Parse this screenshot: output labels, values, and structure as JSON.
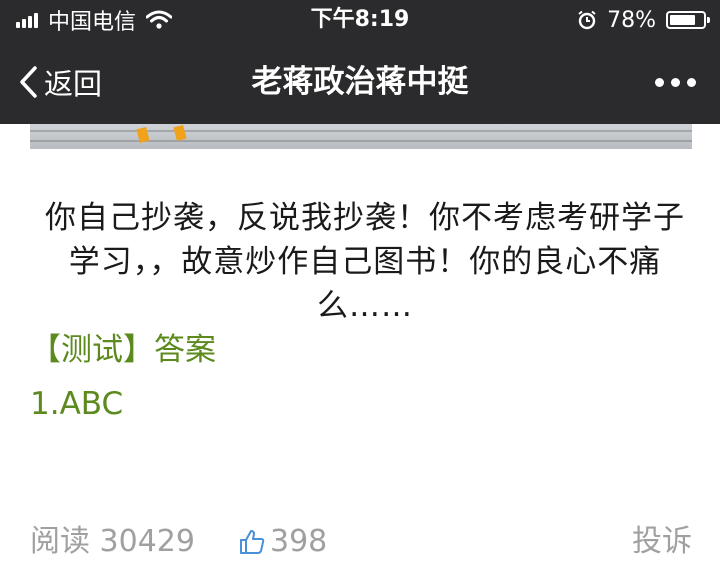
{
  "status_bar": {
    "carrier": "中国电信",
    "time": "下午8:19",
    "battery": "78%",
    "battery_level": 0.78
  },
  "nav": {
    "back_label": "返回",
    "title": "老蒋政治蒋中挺"
  },
  "article": {
    "body": "你自己抄袭，反说我抄袭！你不考虑考研学子学习，，故意炒作自己图书！你的良心不痛么……",
    "answer_title": "【测试】答案",
    "answer_line": "1.ABC"
  },
  "footer": {
    "read_label": "阅读 30429",
    "like_count": "398",
    "report_label": "投诉"
  },
  "colors": {
    "bar_background": "#2b2b2d",
    "answer_green": "#5c8a1e",
    "muted_gray": "#a0a0a0"
  }
}
